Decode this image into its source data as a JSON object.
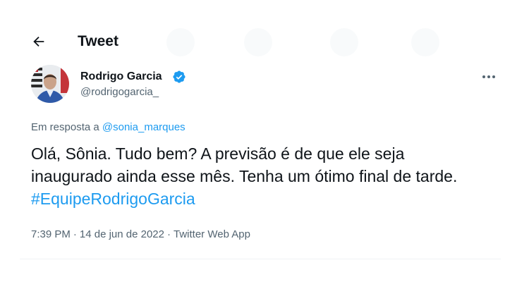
{
  "header": {
    "back_icon": "arrow-left-icon",
    "title": "Tweet"
  },
  "author": {
    "name": "Rodrigo Garcia",
    "handle": "@rodrigogarcia_",
    "verified_icon": "verified-badge-icon",
    "verified_color": "#1d9bf0"
  },
  "more_icon": "more-horizontal-icon",
  "reply": {
    "prefix": "Em resposta a",
    "mention": "@sonia_marques"
  },
  "tweet": {
    "text": "Olá, Sônia. Tudo bem? A previsão é de que ele seja inaugurado ainda esse mês. Tenha um ótimo final de tarde. ",
    "hashtag": "#EquipeRodrigoGarcia"
  },
  "meta": {
    "time": "7:39 PM",
    "separator": "·",
    "date": "14 de jun de 2022",
    "app": "Twitter Web App"
  },
  "colors": {
    "accent": "#1d9bf0",
    "text": "#0f1419",
    "secondary": "#536471"
  }
}
